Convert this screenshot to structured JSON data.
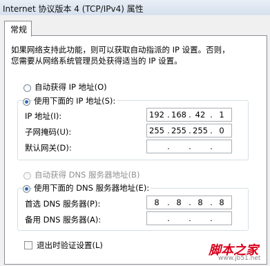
{
  "window": {
    "title": "Internet 协议版本 4 (TCP/IPv4) 属性"
  },
  "tabs": [
    {
      "label": "常规"
    }
  ],
  "description": {
    "line1": "如果网络支持此功能，则可以获取自动指派的 IP 设置。否则，",
    "line2": "您需要从网络系统管理员处获得适当的 IP 设置。"
  },
  "ip_section": {
    "auto_label": "自动获得 IP 地址(O)",
    "manual_label": "使用下面的 IP 地址(S):",
    "selected": "manual",
    "fields": [
      {
        "label": "IP 地址(I):",
        "octets": [
          "192",
          "168",
          "42",
          "1"
        ]
      },
      {
        "label": "子网掩码(U):",
        "octets": [
          "255",
          "255",
          "255",
          "0"
        ]
      },
      {
        "label": "默认网关(D):",
        "octets": [
          "",
          "",
          "",
          ""
        ]
      }
    ]
  },
  "dns_section": {
    "auto_label": "自动获得 DNS 服务器地址(B)",
    "manual_label": "使用下面的 DNS 服务器地址(E):",
    "selected": "manual",
    "fields": [
      {
        "label": "首选 DNS 服务器(P):",
        "octets": [
          "8",
          "8",
          "8",
          "8"
        ]
      },
      {
        "label": "备用 DNS 服务器(A):",
        "octets": [
          "",
          "",
          "",
          ""
        ]
      }
    ]
  },
  "validate_checkbox": {
    "label": "退出时验证设置(L)",
    "checked": false
  },
  "watermark": {
    "text": "脚本之家",
    "url": "www.jb51.net"
  }
}
